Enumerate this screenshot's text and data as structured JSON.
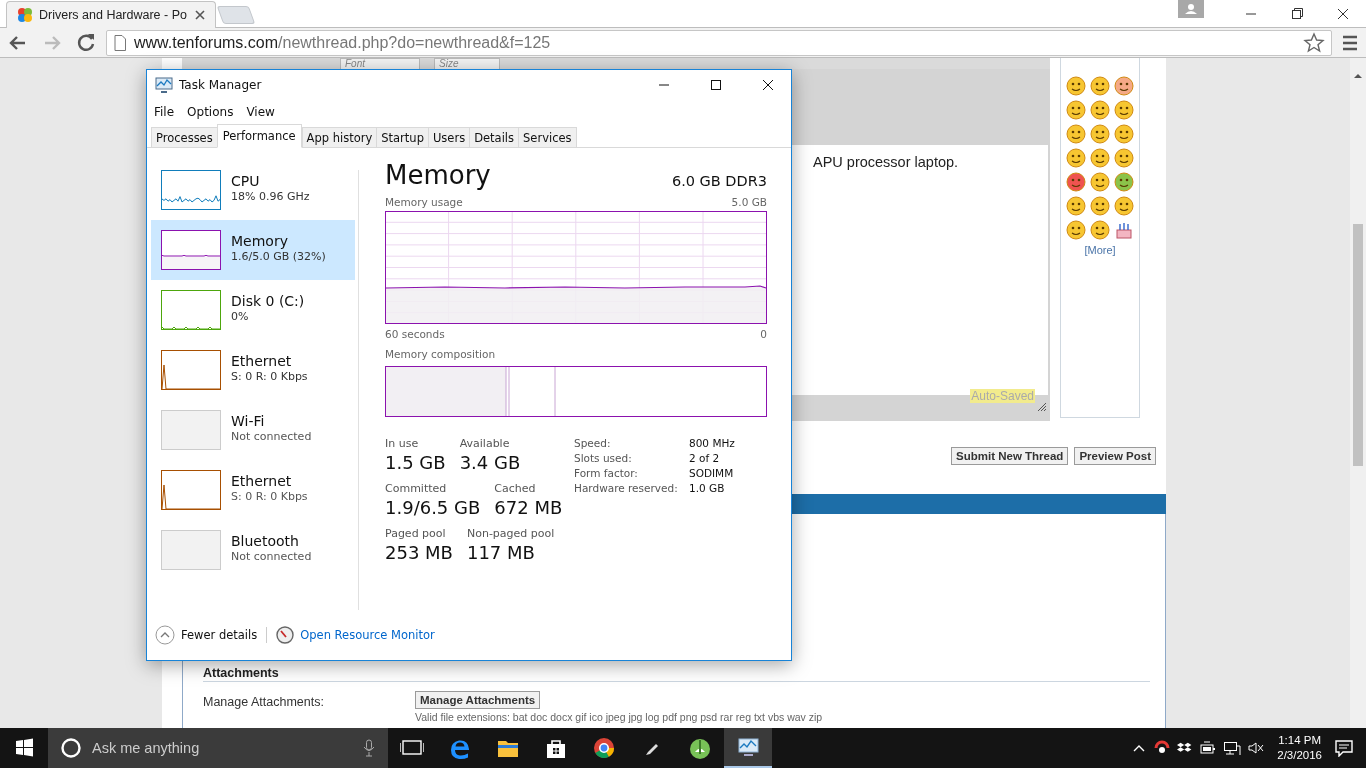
{
  "browser": {
    "tab": {
      "title": "Drivers and Hardware - Po",
      "selected": true
    },
    "url": {
      "host": "www.tenforums.com",
      "path": "/newthread.php?do=newthread&f=125"
    }
  },
  "page": {
    "editor_toolbar": {
      "font_field": "Font",
      "size_field": "Size"
    },
    "editor_text": "APU processor laptop.",
    "auto_saved": "Auto-Saved",
    "smilies_more": "[More]",
    "buttons": [
      "Submit New Thread",
      "Preview Post"
    ],
    "attachments": {
      "heading": "Attachments",
      "label": "Manage Attachments:",
      "button": "Manage Attachments",
      "note": "Valid file extensions: bat doc docx gif ico jpeg jpg log pdf png psd rar reg txt vbs wav zip"
    }
  },
  "task_manager": {
    "title": "Task Manager",
    "menu": [
      "File",
      "Options",
      "View"
    ],
    "tabs": [
      {
        "label": "Processes",
        "selected": false
      },
      {
        "label": "Performance",
        "selected": true
      },
      {
        "label": "App history",
        "selected": false
      },
      {
        "label": "Startup",
        "selected": false
      },
      {
        "label": "Users",
        "selected": false
      },
      {
        "label": "Details",
        "selected": false
      },
      {
        "label": "Services",
        "selected": false
      }
    ],
    "resources": [
      {
        "kind": "graph",
        "name": "CPU",
        "detail": "18%  0.96 GHz",
        "color": "#117dbb",
        "selected": false
      },
      {
        "kind": "graph",
        "name": "Memory",
        "detail": "1.6/5.0 GB (32%)",
        "color": "#8b12ae",
        "selected": true
      },
      {
        "kind": "graph",
        "name": "Disk 0 (C:)",
        "detail": "0%",
        "color": "#4da60c",
        "selected": false
      },
      {
        "kind": "graph",
        "name": "Ethernet",
        "detail": "S: 0 R: 0 Kbps",
        "color": "#a74f01",
        "selected": false
      },
      {
        "kind": "disconnected",
        "name": "Wi-Fi",
        "detail": "Not connected",
        "selected": false
      },
      {
        "kind": "graph",
        "name": "Ethernet",
        "detail": "S: 0 R: 0 Kbps",
        "color": "#a74f01",
        "selected": false
      },
      {
        "kind": "disconnected",
        "name": "Bluetooth",
        "detail": "Not connected",
        "selected": false
      }
    ],
    "pane": {
      "title": "Memory",
      "spec": "6.0 GB DDR3",
      "usage_label": "Memory usage",
      "usage_max": "5.0 GB",
      "time_span": "60 seconds",
      "time_end": "0",
      "composition_label": "Memory composition",
      "stats": [
        [
          {
            "label": "In use",
            "value": "1.5 GB"
          },
          {
            "label": "Available",
            "value": "3.4 GB"
          }
        ],
        [
          {
            "label": "Committed",
            "value": "1.9/6.5 GB"
          },
          {
            "label": "Cached",
            "value": "672 MB"
          }
        ],
        [
          {
            "label": "Paged pool",
            "value": "253 MB"
          },
          {
            "label": "Non-paged pool",
            "value": "117 MB"
          }
        ]
      ],
      "details": [
        {
          "label": "Speed:",
          "value": "800 MHz"
        },
        {
          "label": "Slots used:",
          "value": "2 of 2"
        },
        {
          "label": "Form factor:",
          "value": "SODIMM"
        },
        {
          "label": "Hardware reserved:",
          "value": "1.0 GB"
        }
      ]
    },
    "footer": {
      "fewer_details": "Fewer details",
      "resource_monitor": "Open Resource Monitor"
    }
  },
  "taskbar": {
    "search_placeholder": "Ask me anything",
    "apps": [
      {
        "kind": "task-view",
        "selected": false
      },
      {
        "kind": "edge",
        "selected": false
      },
      {
        "kind": "explorer",
        "selected": false
      },
      {
        "kind": "store",
        "selected": false
      },
      {
        "kind": "chrome",
        "selected": false
      },
      {
        "kind": "pen",
        "selected": false
      },
      {
        "kind": "android",
        "selected": false
      },
      {
        "kind": "task-manager",
        "selected": true
      }
    ],
    "time": "1:14 PM",
    "date": "2/3/2016"
  }
}
